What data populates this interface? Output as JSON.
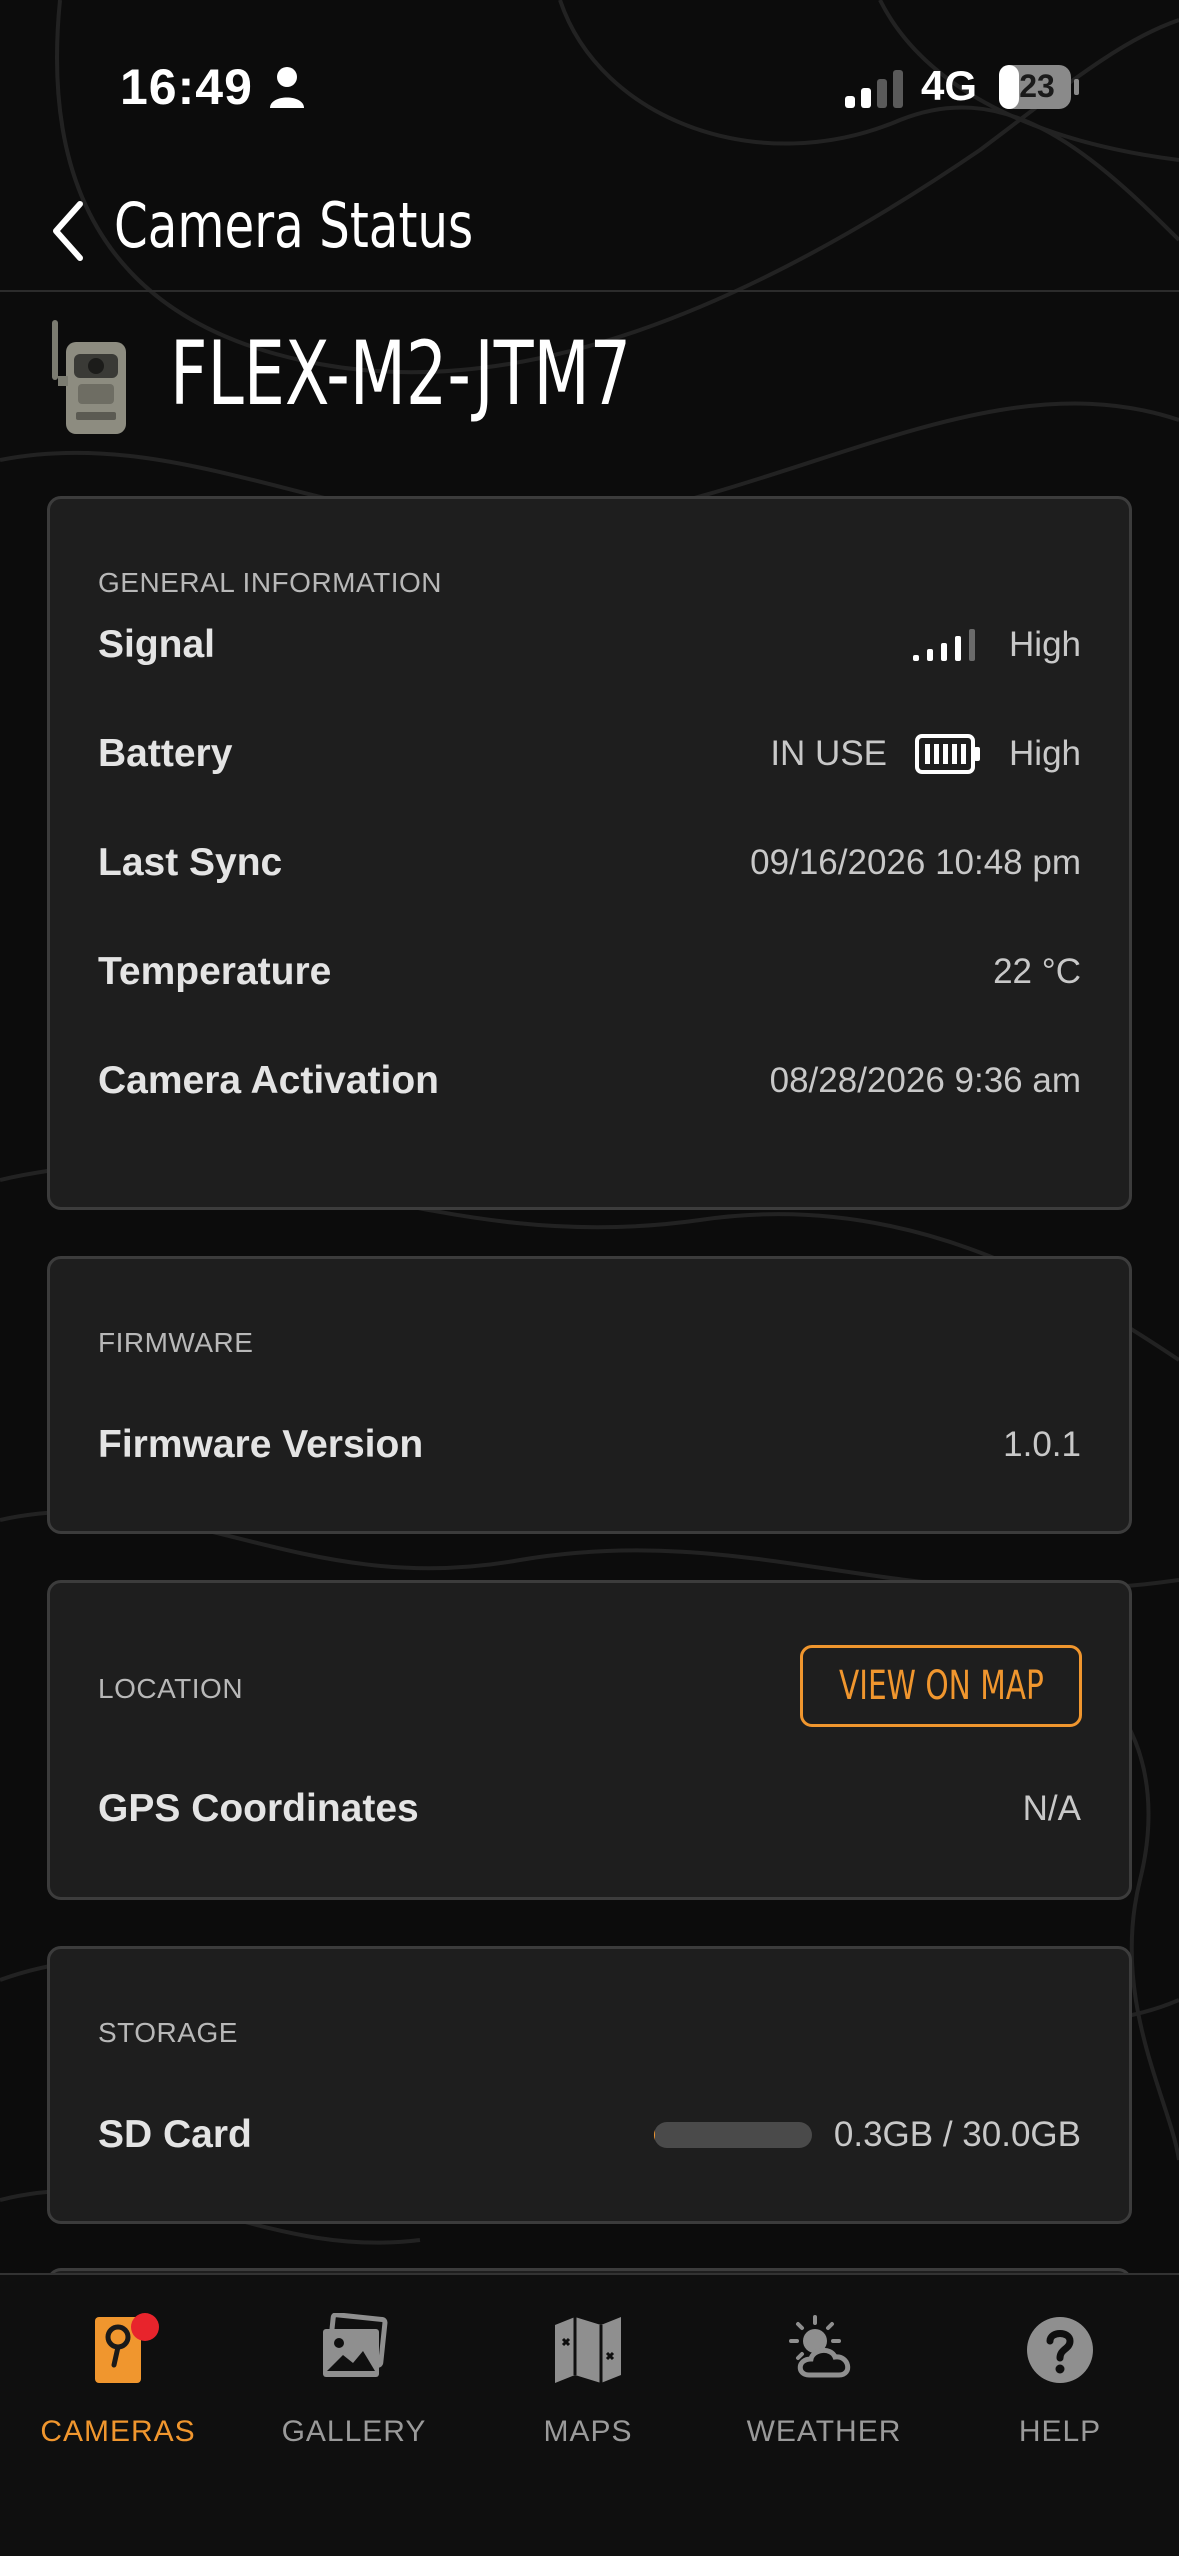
{
  "status_bar": {
    "time": "16:49",
    "network": "4G",
    "battery_level": "23"
  },
  "header": {
    "title": "Camera Status"
  },
  "camera": {
    "name": "FLEX-M2-JTM7"
  },
  "general_information": {
    "section_label": "GENERAL INFORMATION",
    "signal": {
      "label": "Signal",
      "value": "High"
    },
    "battery": {
      "label": "Battery",
      "status": "IN USE",
      "value": "High"
    },
    "last_sync": {
      "label": "Last Sync",
      "value": "09/16/2026 10:48 pm"
    },
    "temperature": {
      "label": "Temperature",
      "value": "22 °C"
    },
    "camera_activation": {
      "label": "Camera Activation",
      "value": "08/28/2026 9:36 am"
    }
  },
  "firmware": {
    "section_label": "FIRMWARE",
    "version": {
      "label": "Firmware Version",
      "value": "1.0.1"
    }
  },
  "location": {
    "section_label": "LOCATION",
    "view_on_map_label": "VIEW ON MAP",
    "gps": {
      "label": "GPS Coordinates",
      "value": "N/A"
    }
  },
  "storage": {
    "section_label": "STORAGE",
    "sd_card": {
      "label": "SD Card",
      "value": "0.3GB / 30.0GB",
      "used_fraction": 0.01
    }
  },
  "tab_bar": {
    "tabs": [
      {
        "label": "CAMERAS",
        "icon": "camera-icon",
        "active": true
      },
      {
        "label": "GALLERY",
        "icon": "gallery-icon",
        "active": false
      },
      {
        "label": "MAPS",
        "icon": "map-icon",
        "active": false
      },
      {
        "label": "WEATHER",
        "icon": "weather-icon",
        "active": false
      },
      {
        "label": "HELP",
        "icon": "help-icon",
        "active": false
      }
    ]
  },
  "colors": {
    "accent": "#f0962e",
    "background": "#0c0c0c",
    "card": "#1e1e1e",
    "notification": "#e8242c"
  }
}
